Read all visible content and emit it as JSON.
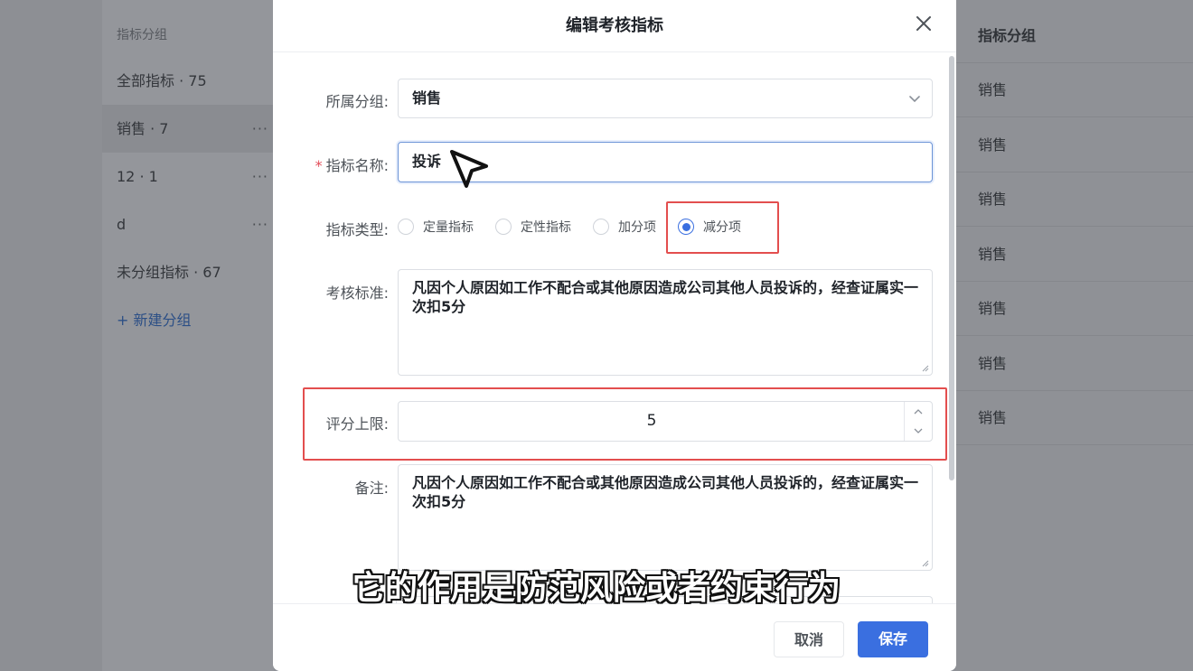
{
  "sidebar": {
    "title": "指标分组",
    "items": [
      {
        "label": "全部指标 · 75"
      },
      {
        "label": "销售 · 7",
        "more": "···"
      },
      {
        "label": "12 · 1",
        "more": "···"
      },
      {
        "label": "d",
        "more": "···"
      },
      {
        "label": "未分组指标 · 67"
      }
    ],
    "add_label": "+ 新建分组"
  },
  "right_table": {
    "header": "指标分组",
    "rows": [
      "销售",
      "销售",
      "销售",
      "销售",
      "销售",
      "销售",
      "销售"
    ]
  },
  "modal": {
    "title": "编辑考核指标",
    "fields": {
      "group_label": "所属分组:",
      "group_value": "销售",
      "name_required_mark": "*",
      "name_label": "指标名称:",
      "name_value": "投诉",
      "type_label": "指标类型:",
      "type_options": [
        "定量指标",
        "定性指标",
        "加分项",
        "减分项"
      ],
      "type_selected": "减分项",
      "standard_label": "考核标准:",
      "standard_value": "凡因个人原因如工作不配合或其他原因造成公司其他人员投诉的，经查证属实一次扣5分",
      "limit_label": "评分上限:",
      "limit_value": "5",
      "remark_label": "备注:",
      "remark_value": "凡因个人原因如工作不配合或其他原因造成公司其他人员投诉的，经查证属实一次扣5分"
    },
    "buttons": {
      "cancel": "取消",
      "save": "保存"
    }
  },
  "subtitle": "它的作用是防范风险或者约束行为",
  "colors": {
    "primary": "#3a6fe0",
    "highlight": "#e34e4e",
    "required": "#e34d59"
  }
}
